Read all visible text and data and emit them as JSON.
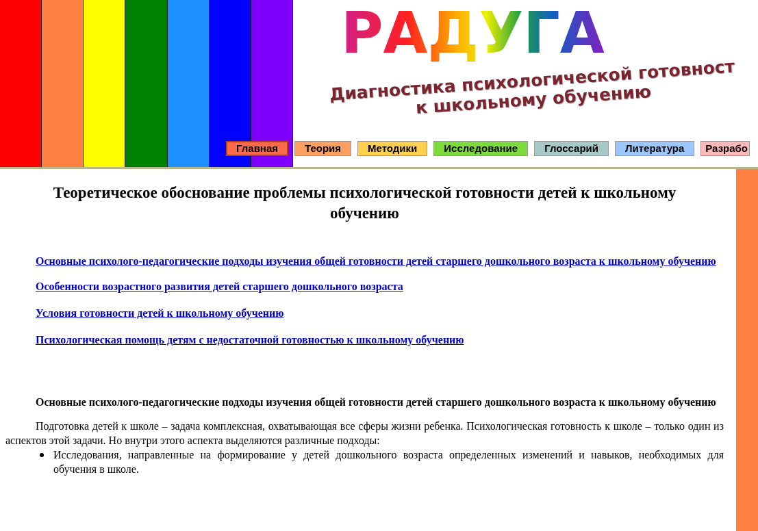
{
  "header": {
    "stripes": [
      {
        "color": "#ff0000"
      },
      {
        "color": "#ff8040"
      },
      {
        "color": "#ffff00"
      },
      {
        "color": "#008000"
      },
      {
        "color": "#1e90ff"
      },
      {
        "color": "#0000ff"
      },
      {
        "color": "#8000ff"
      }
    ],
    "logo": "РАДУГА",
    "subtitle": [
      "Диагностика психологической готовност",
      "к школьному обучению"
    ],
    "nav": [
      {
        "label": "Главная",
        "color": "#ff6a4a",
        "selected": true
      },
      {
        "label": "Теория",
        "color": "#ffa060",
        "selected": false
      },
      {
        "label": "Методики",
        "color": "#ffd050",
        "selected": false
      },
      {
        "label": "Исследование",
        "color": "#7ddc3c",
        "selected": false
      },
      {
        "label": "Глоссарий",
        "color": "#a6c8c6",
        "selected": false
      },
      {
        "label": "Литература",
        "color": "#9cc8ff",
        "selected": false
      },
      {
        "label": "Разрабо",
        "color": "#ffb8b8",
        "selected": false
      }
    ]
  },
  "title": "Теоретическое обоснование проблемы психологической готовности детей к школьному обучению",
  "links": [
    "Основные психолого-педагогические подходы изучения общей готовности детей старшего дошкольного возраста к школьному обучению",
    "Особенности возрастного развития детей старшего дошкольного возраста",
    "Условия готовности детей к школьному обучению",
    "Психологическая помощь детям с недостаточной готовностью к школьному обучению"
  ],
  "section": {
    "heading": "Основные психолого-педагогические подходы изучения общей готовности детей старшего дошкольного возраста к школьному обучению",
    "paragraph": "Подготовка детей к школе – задача комплексная, охватывающая все сферы жизни ребенка. Психологическая готовность к школе – только один из аспектов этой задачи. Но внутри этого аспекта выделяются различные подходы:",
    "bullets": [
      "Исследования, направленные на формирование у детей дошкольного возраста определенных изменений и навыков, необходимых для обучения в школе."
    ]
  }
}
